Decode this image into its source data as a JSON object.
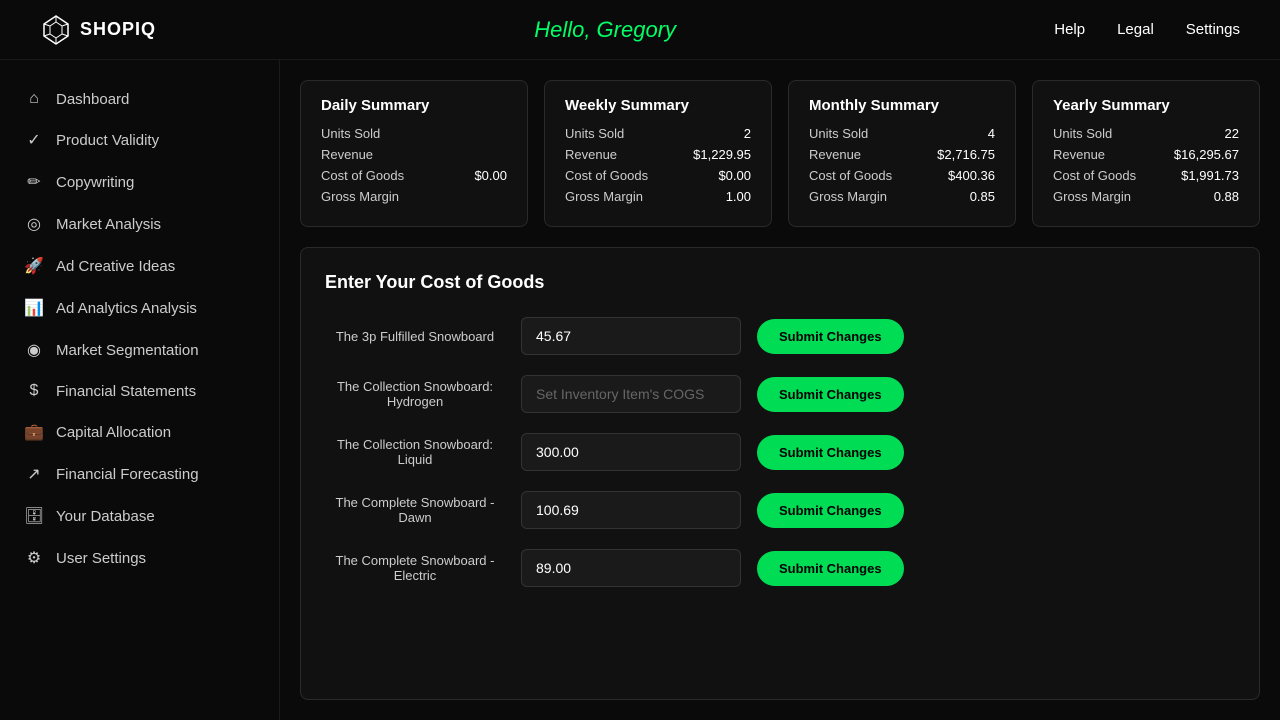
{
  "header": {
    "logo_text": "SHOPIQ",
    "greeting": "Hello, Gregory",
    "nav": [
      {
        "label": "Help",
        "key": "help"
      },
      {
        "label": "Legal",
        "key": "legal"
      },
      {
        "label": "Settings",
        "key": "settings"
      }
    ]
  },
  "sidebar": {
    "items": [
      {
        "key": "dashboard",
        "icon": "⌂",
        "label": "Dashboard"
      },
      {
        "key": "product-validity",
        "icon": "✓",
        "label": "Product Validity"
      },
      {
        "key": "copywriting",
        "icon": "✏",
        "label": "Copywriting"
      },
      {
        "key": "market-analysis",
        "icon": "◎",
        "label": "Market Analysis"
      },
      {
        "key": "ad-creative-ideas",
        "icon": "🚀",
        "label": "Ad Creative Ideas"
      },
      {
        "key": "ad-analytics",
        "icon": "📊",
        "label": "Ad Analytics Analysis"
      },
      {
        "key": "market-segmentation",
        "icon": "◉",
        "label": "Market Segmentation"
      },
      {
        "key": "financial-statements",
        "icon": "$",
        "label": "Financial Statements"
      },
      {
        "key": "capital-allocation",
        "icon": "💼",
        "label": "Capital Allocation"
      },
      {
        "key": "financial-forecasting",
        "icon": "↗",
        "label": "Financial Forecasting"
      },
      {
        "key": "your-database",
        "icon": "🗄",
        "label": "Your Database"
      },
      {
        "key": "user-settings",
        "icon": "⚙",
        "label": "User Settings"
      }
    ]
  },
  "summaries": [
    {
      "title": "Daily Summary",
      "units_sold_label": "Units Sold",
      "units_sold_value": "",
      "revenue_label": "Revenue",
      "revenue_value": "",
      "cog_label": "Cost of Goods",
      "cog_value": "$0.00",
      "margin_label": "Gross Margin",
      "margin_value": ""
    },
    {
      "title": "Weekly Summary",
      "units_sold_label": "Units Sold",
      "units_sold_value": "2",
      "revenue_label": "Revenue",
      "revenue_value": "$1,229.95",
      "cog_label": "Cost of Goods",
      "cog_value": "$0.00",
      "margin_label": "Gross Margin",
      "margin_value": "1.00"
    },
    {
      "title": "Monthly Summary",
      "units_sold_label": "Units Sold",
      "units_sold_value": "4",
      "revenue_label": "Revenue",
      "revenue_value": "$2,716.75",
      "cog_label": "Cost of Goods",
      "cog_value": "$400.36",
      "margin_label": "Gross Margin",
      "margin_value": "0.85"
    },
    {
      "title": "Yearly Summary",
      "units_sold_label": "Units Sold",
      "units_sold_value": "22",
      "revenue_label": "Revenue",
      "revenue_value": "$16,295.67",
      "cog_label": "Cost of Goods",
      "cog_value": "$1,991.73",
      "margin_label": "Gross Margin",
      "margin_value": "0.88"
    }
  ],
  "cog_section": {
    "title": "Enter Your Cost of Goods",
    "rows": [
      {
        "product": "The 3p Fulfilled Snowboard",
        "value": "45.67",
        "placeholder": ""
      },
      {
        "product": "The Collection Snowboard: Hydrogen",
        "value": "",
        "placeholder": "Set Inventory Item's COGS"
      },
      {
        "product": "The Collection Snowboard: Liquid",
        "value": "300.00",
        "placeholder": ""
      },
      {
        "product": "The Complete Snowboard - Dawn",
        "value": "100.69",
        "placeholder": ""
      },
      {
        "product": "The Complete Snowboard - Electric",
        "value": "89.00",
        "placeholder": ""
      }
    ],
    "submit_label": "Submit Changes"
  }
}
